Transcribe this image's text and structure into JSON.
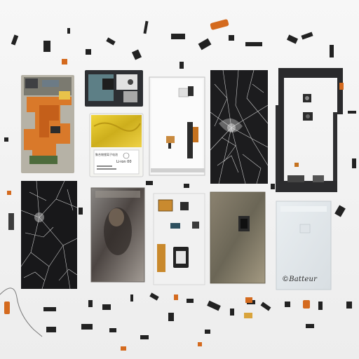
{
  "scene": {
    "description_alt": "",
    "background": "#f4f4f4"
  },
  "battery": {
    "label_line1": "Li-ion 00",
    "label_line2": "聚合物锂离子电池"
  },
  "signature": {
    "text": "©Batteur"
  },
  "colors": {
    "flex_orange": "#d9792a",
    "battery_yellow": "#e8c92a",
    "glass_dark": "#1c1c1e",
    "frame_dark": "#2a2a2c",
    "copper_orange": "#d46a1e"
  }
}
